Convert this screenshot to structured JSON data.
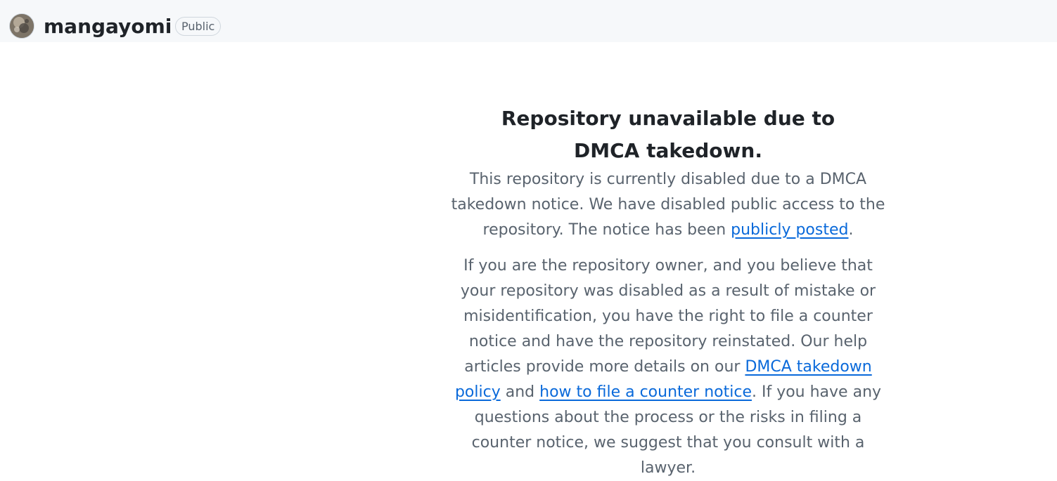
{
  "header": {
    "repo_name": "mangayomi",
    "visibility_badge": "Public",
    "avatar_icon": "user-avatar"
  },
  "notice": {
    "title": "Repository unavailable due to DMCA takedown.",
    "para1_text": "This repository is currently disabled due to a DMCA takedown notice. We have disabled public access to the repository. The notice has been ",
    "para1_link": "publicly posted",
    "para1_end": ".",
    "para2_text": "If you are the repository owner, and you believe that your repository was disabled as a result of mistake or misidentification, you have the right to file a counter notice and have the repository reinstated. Our help articles provide more details on our ",
    "para2_link1": "DMCA takedown policy",
    "para2_mid": " and ",
    "para2_link2": "how to file a counter notice",
    "para2_end": ". If you have any questions about the process or the risks in filing a counter notice, we suggest that you consult with a lawyer."
  },
  "colors": {
    "header_bg": "#f6f8fa",
    "link": "#0969da",
    "muted_text": "#59636e",
    "heading_text": "#1f2328"
  }
}
